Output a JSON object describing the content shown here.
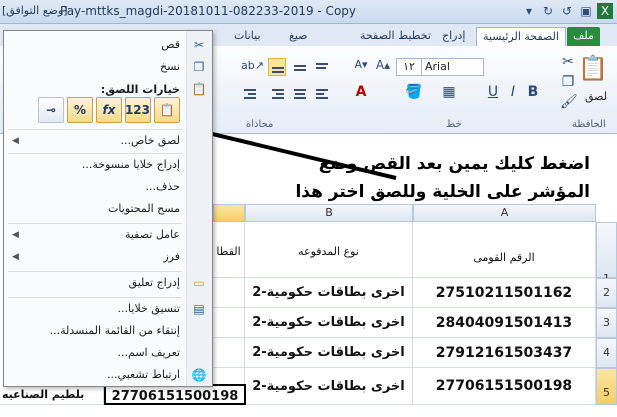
{
  "titlebar": {
    "mode_label": "[وضع التوافق]",
    "document_title": "Pay-mttks_magdi-20181011-082233-2019 - Copy"
  },
  "tabs": [
    {
      "label": "ملف",
      "active": false,
      "file": true
    },
    {
      "label": "الصفحة الرئيسية",
      "active": true
    },
    {
      "label": "إدراج"
    },
    {
      "label": "تخطيط الصفحة"
    },
    {
      "label": "صيغ"
    },
    {
      "label": "بيانات"
    }
  ],
  "ribbon": {
    "font_name": "Arial",
    "font_size": "١٢",
    "paste_label": "لصق",
    "clipboard_group": "الحافظة",
    "font_group": "خط",
    "alignment_group": "محاذاة"
  },
  "context_menu": {
    "cut": "قص",
    "copy": "نسخ",
    "paste_options_title": "خيارات اللصق:",
    "paste_options": [
      "fx-paste",
      "values-123",
      "formulas-fx",
      "percent-fx",
      "link"
    ],
    "items": [
      {
        "label": "لصق خاص...",
        "submenu": true
      },
      {
        "label": "إدراج خلايا منسوخة..."
      },
      {
        "label": "حذف..."
      },
      {
        "label": "مسح المحتويات"
      },
      {
        "label": "عامل تصفية",
        "submenu": true
      },
      {
        "label": "فرز",
        "submenu": true
      },
      {
        "label": "إدراج تعليق"
      },
      {
        "label": "تنسيق خلايا..."
      },
      {
        "label": "إنتقاء من القائمة المنسدلة..."
      },
      {
        "label": "تعريف اسم..."
      },
      {
        "label": "ارتباط تشعبي..."
      }
    ]
  },
  "annotation": {
    "line1": "اضغط كليك يمين بعد القص وضع",
    "line2": "المؤشر على الخلية وللصق اختر هذا"
  },
  "sheet": {
    "col_a": "A",
    "col_b": "B",
    "header_a": "الرقم القومى",
    "header_b": "نوع المدفوعه",
    "header_c": "القطا",
    "row_numbers": [
      "1",
      "2",
      "3",
      "4",
      "5"
    ],
    "rows": [
      {
        "a": "27510211501162",
        "b": "اخرى بطاقات حكومية-2"
      },
      {
        "a": "28404091501413",
        "b": "اخرى بطاقات حكومية-2"
      },
      {
        "a": "27912161503437",
        "b": "اخرى بطاقات حكومية-2"
      },
      {
        "a": "27706151500198",
        "b": "اخرى بطاقات حكومية-2"
      }
    ],
    "pasted_value": "27706151500198",
    "left_cell_text": "بلطيم الصناعيه"
  }
}
